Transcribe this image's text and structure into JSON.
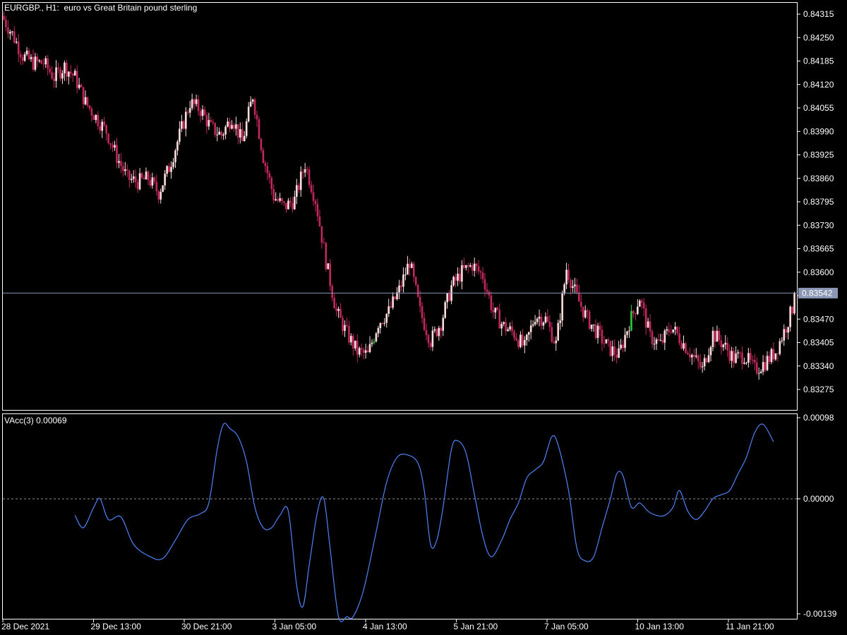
{
  "header": {
    "symbol": "EURGBP., H1:",
    "description": "euro vs Great Britain pound sterling"
  },
  "indicator": {
    "name": "VAcc(3)",
    "value": "0.00069"
  },
  "colors": {
    "background": "#000000",
    "frame": "#ffffff",
    "bear_candle": "#c2285d",
    "bull_candle": "#ffdede",
    "bull_highlight": "#2ecc40",
    "price_line": "#8a96b4",
    "vacc_line": "#4f82f7",
    "zero_line": "#8a8a8a",
    "price_tag_bg": "#8a96b4"
  },
  "chart_data": [
    {
      "type": "candlestick",
      "title": "EURGBP., H1:  euro vs Great Britain pound sterling",
      "y_ticks": [
        "0.84315",
        "0.84250",
        "0.84185",
        "0.84120",
        "0.84055",
        "0.83990",
        "0.83925",
        "0.83860",
        "0.83795",
        "0.83730",
        "0.83665",
        "0.83600",
        "0.83535",
        "0.83470",
        "0.83405",
        "0.83340",
        "0.83275"
      ],
      "ylim": [
        0.8322,
        0.8434
      ],
      "current_price": "0.83542",
      "x_ticks": [
        "28 Dec 2021",
        "29 Dec 13:00",
        "30 Dec 21:00",
        "3 Jan 05:00",
        "4 Jan 13:00",
        "5 Jan 21:00",
        "7 Jan 05:00",
        "10 Jan 13:00",
        "11 Jan 21:00"
      ],
      "close_trend": [
        [
          0,
          0.8431
        ],
        [
          5,
          0.8426
        ],
        [
          10,
          0.842
        ],
        [
          15,
          0.8418
        ],
        [
          20,
          0.8418
        ],
        [
          25,
          0.8414
        ],
        [
          30,
          0.8417
        ],
        [
          35,
          0.8414
        ],
        [
          40,
          0.8407
        ],
        [
          45,
          0.8403
        ],
        [
          50,
          0.8399
        ],
        [
          55,
          0.8392
        ],
        [
          60,
          0.8386
        ],
        [
          65,
          0.8385
        ],
        [
          70,
          0.8386
        ],
        [
          75,
          0.8382
        ],
        [
          80,
          0.8389
        ],
        [
          85,
          0.8398
        ],
        [
          90,
          0.8407
        ],
        [
          95,
          0.8405
        ],
        [
          100,
          0.84
        ],
        [
          105,
          0.8398
        ],
        [
          110,
          0.8403
        ],
        [
          115,
          0.8396
        ],
        [
          120,
          0.8409
        ],
        [
          125,
          0.8392
        ],
        [
          130,
          0.8381
        ],
        [
          135,
          0.8378
        ],
        [
          140,
          0.838
        ],
        [
          145,
          0.839
        ],
        [
          150,
          0.838
        ],
        [
          155,
          0.8363
        ],
        [
          160,
          0.8349
        ],
        [
          165,
          0.8343
        ],
        [
          170,
          0.8338
        ],
        [
          175,
          0.8337
        ],
        [
          180,
          0.8346
        ],
        [
          185,
          0.8349
        ],
        [
          190,
          0.8355
        ],
        [
          195,
          0.8363
        ],
        [
          200,
          0.8349
        ],
        [
          205,
          0.8341
        ],
        [
          210,
          0.8346
        ],
        [
          215,
          0.8356
        ],
        [
          220,
          0.836
        ],
        [
          225,
          0.8362
        ],
        [
          230,
          0.8359
        ],
        [
          235,
          0.8349
        ],
        [
          240,
          0.8345
        ],
        [
          245,
          0.8343
        ],
        [
          250,
          0.8339
        ],
        [
          255,
          0.8348
        ],
        [
          260,
          0.8347
        ],
        [
          265,
          0.834
        ],
        [
          270,
          0.8361
        ],
        [
          275,
          0.8353
        ],
        [
          280,
          0.8347
        ],
        [
          285,
          0.8343
        ],
        [
          290,
          0.8339
        ],
        [
          295,
          0.8337
        ],
        [
          300,
          0.8346
        ],
        [
          305,
          0.8353
        ],
        [
          310,
          0.8342
        ],
        [
          315,
          0.834
        ],
        [
          320,
          0.8345
        ],
        [
          325,
          0.8341
        ],
        [
          330,
          0.8337
        ],
        [
          335,
          0.8333
        ],
        [
          340,
          0.8343
        ],
        [
          345,
          0.834
        ],
        [
          350,
          0.8336
        ],
        [
          355,
          0.8337
        ],
        [
          360,
          0.8333
        ],
        [
          365,
          0.8335
        ],
        [
          370,
          0.8338
        ],
        [
          375,
          0.8345
        ],
        [
          378,
          0.835
        ]
      ]
    },
    {
      "type": "line",
      "title": "VAcc(3) 0.00069",
      "y_ticks": [
        "0.00098",
        "0.00000",
        "-0.00139"
      ],
      "ylim": [
        -0.00139,
        0.00098
      ],
      "zero_level": 0.0,
      "series": [
        {
          "values": [
            [
              34,
              -0.0002
            ],
            [
              38,
              -0.00035
            ],
            [
              43,
              -0.0001
            ],
            [
              46,
              0.0
            ],
            [
              50,
              -0.00025
            ],
            [
              56,
              -0.00022
            ],
            [
              62,
              -0.00055
            ],
            [
              70,
              -0.0007
            ],
            [
              76,
              -0.00072
            ],
            [
              82,
              -0.0005
            ],
            [
              88,
              -0.00025
            ],
            [
              94,
              -0.00018
            ],
            [
              98,
              -5e-05
            ],
            [
              102,
              0.0006
            ],
            [
              105,
              0.0009
            ],
            [
              108,
              0.00085
            ],
            [
              112,
              0.00075
            ],
            [
              116,
              0.00045
            ],
            [
              120,
              -0.0001
            ],
            [
              124,
              -0.00035
            ],
            [
              128,
              -0.00035
            ],
            [
              132,
              -0.0002
            ],
            [
              136,
              -0.00015
            ],
            [
              140,
              -0.00105
            ],
            [
              143,
              -0.0013
            ],
            [
              146,
              -0.0008
            ],
            [
              150,
              -0.00015
            ],
            [
              153,
              0.0
            ],
            [
              156,
              -0.0006
            ],
            [
              160,
              -0.0017
            ],
            [
              164,
              -0.0021
            ],
            [
              167,
              -0.002
            ],
            [
              172,
              -0.0011
            ],
            [
              178,
              -0.0004
            ],
            [
              183,
              0.0002
            ],
            [
              188,
              0.0005
            ],
            [
              193,
              0.00053
            ],
            [
              198,
              0.00043
            ],
            [
              201,
              0.0001
            ],
            [
              204,
              -0.00055
            ],
            [
              207,
              -0.0005
            ],
            [
              210,
              -0.0001
            ],
            [
              214,
              0.0006
            ],
            [
              217,
              0.0007
            ],
            [
              221,
              0.00055
            ],
            [
              225,
              5e-05
            ],
            [
              229,
              -0.00045
            ],
            [
              233,
              -0.0007
            ],
            [
              238,
              -0.0005
            ],
            [
              242,
              -0.00025
            ],
            [
              246,
              -5e-05
            ],
            [
              250,
              0.00025
            ],
            [
              254,
              0.00035
            ],
            [
              258,
              0.00045
            ],
            [
              262,
              0.00075
            ],
            [
              265,
              0.00065
            ],
            [
              270,
              0.0001
            ],
            [
              274,
              -0.0006
            ],
            [
              278,
              -0.00075
            ],
            [
              282,
              -0.0007
            ],
            [
              286,
              -0.00035
            ],
            [
              290,
              0.0
            ],
            [
              293,
              0.0003
            ],
            [
              296,
              0.00028
            ],
            [
              300,
              -0.0001
            ],
            [
              304,
              -5e-05
            ],
            [
              308,
              -0.00015
            ],
            [
              312,
              -0.0002
            ],
            [
              316,
              -0.0002
            ],
            [
              320,
              -0.0001
            ],
            [
              323,
              0.0001
            ],
            [
              327,
              -0.00015
            ],
            [
              331,
              -0.00025
            ],
            [
              335,
              -0.00015
            ],
            [
              339,
              0.0
            ],
            [
              343,
              5e-05
            ],
            [
              347,
              0.0001
            ],
            [
              351,
              0.0003
            ],
            [
              355,
              0.0005
            ],
            [
              359,
              0.0008
            ],
            [
              363,
              0.0009
            ],
            [
              368,
              0.00069
            ]
          ]
        }
      ]
    }
  ]
}
